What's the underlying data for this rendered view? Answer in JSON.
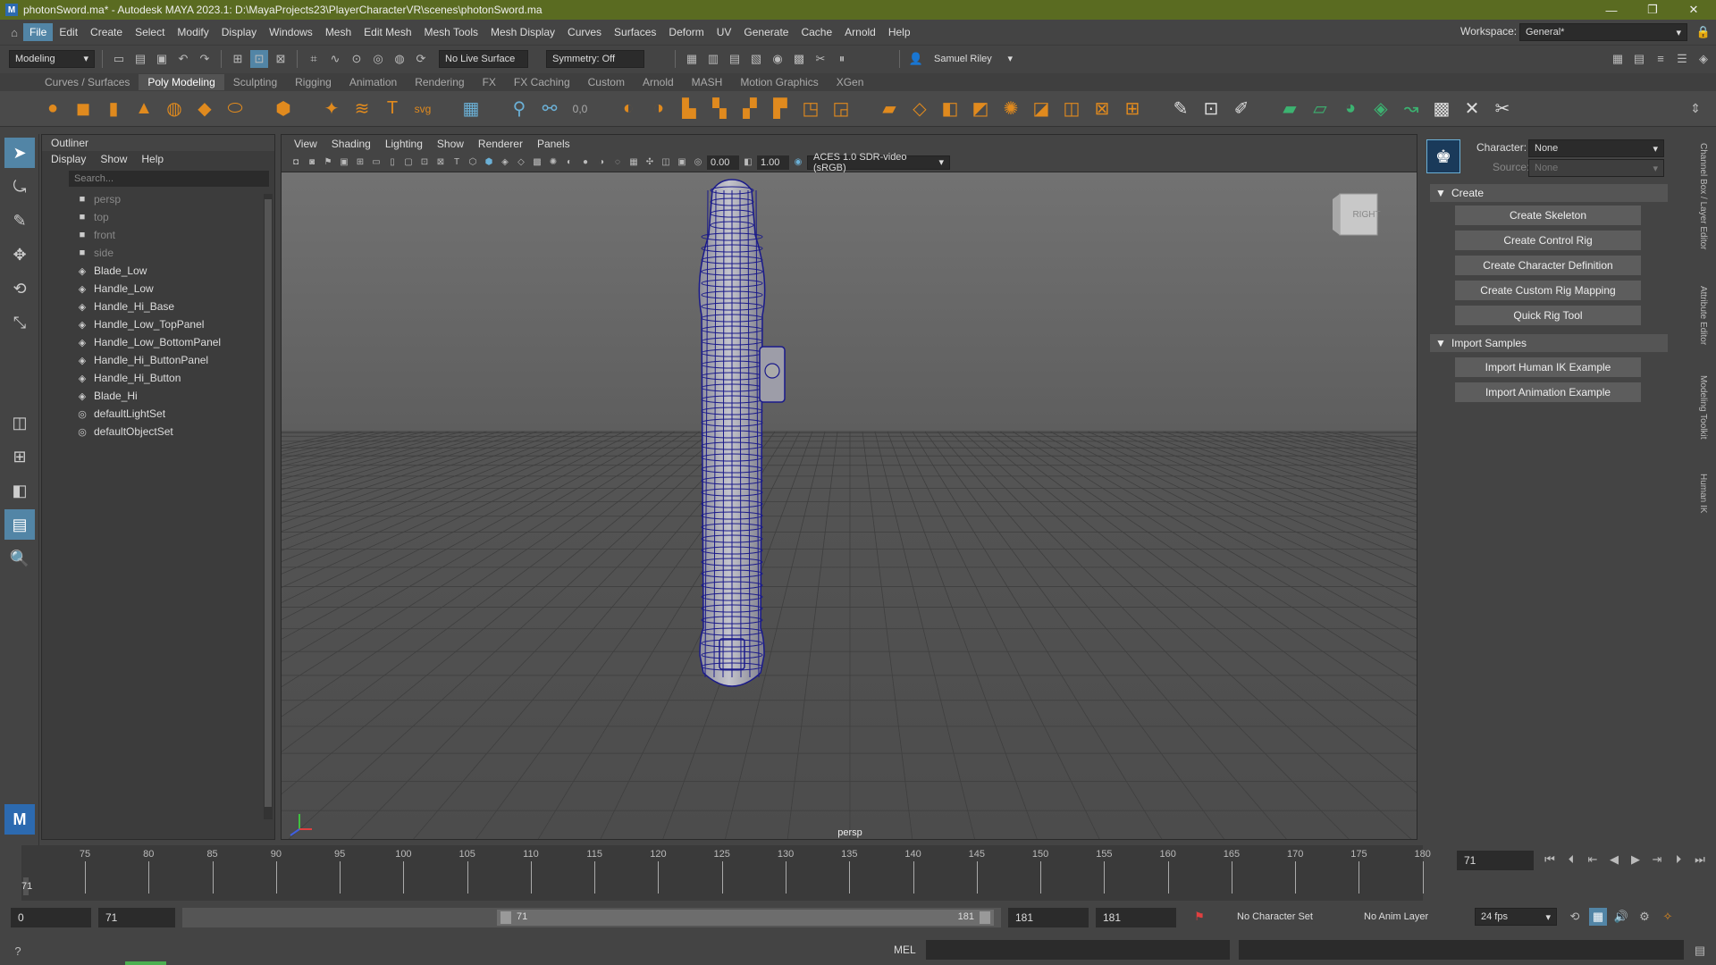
{
  "titlebar": {
    "title": "photonSword.ma* - Autodesk MAYA 2023.1: D:\\MayaProjects23\\PlayerCharacterVR\\scenes\\photonSword.ma",
    "minimize": "—",
    "maximize": "❐",
    "close": "✕"
  },
  "menubar": {
    "items": [
      "File",
      "Edit",
      "Create",
      "Select",
      "Modify",
      "Display",
      "Windows",
      "Mesh",
      "Edit Mesh",
      "Mesh Tools",
      "Mesh Display",
      "Curves",
      "Surfaces",
      "Deform",
      "UV",
      "Generate",
      "Cache",
      "Arnold",
      "Help"
    ],
    "workspace_label": "Workspace:",
    "workspace_value": "General*"
  },
  "statusline": {
    "mode": "Modeling",
    "live_surface": "No Live Surface",
    "symmetry": "Symmetry: Off",
    "user": "Samuel Riley"
  },
  "shelf": {
    "tabs": [
      "Curves / Surfaces",
      "Poly Modeling",
      "Sculpting",
      "Rigging",
      "Animation",
      "Rendering",
      "FX",
      "FX Caching",
      "Custom",
      "Arnold",
      "MASH",
      "Motion Graphics",
      "XGen"
    ],
    "active_tab": "Poly Modeling"
  },
  "outliner": {
    "title": "Outliner",
    "menu": [
      "Display",
      "Show",
      "Help"
    ],
    "search_placeholder": "Search...",
    "items": [
      {
        "label": "persp",
        "icon": "camera-icon",
        "dim": true
      },
      {
        "label": "top",
        "icon": "camera-icon",
        "dim": true
      },
      {
        "label": "front",
        "icon": "camera-icon",
        "dim": true
      },
      {
        "label": "side",
        "icon": "camera-icon",
        "dim": true
      },
      {
        "label": "Blade_Low",
        "icon": "mesh-icon",
        "dim": false
      },
      {
        "label": "Handle_Low",
        "icon": "mesh-icon",
        "dim": false
      },
      {
        "label": "Handle_Hi_Base",
        "icon": "mesh-icon",
        "dim": false
      },
      {
        "label": "Handle_Low_TopPanel",
        "icon": "mesh-icon",
        "dim": false
      },
      {
        "label": "Handle_Low_BottomPanel",
        "icon": "mesh-icon",
        "dim": false
      },
      {
        "label": "Handle_Hi_ButtonPanel",
        "icon": "mesh-icon",
        "dim": false
      },
      {
        "label": "Handle_Hi_Button",
        "icon": "mesh-icon",
        "dim": false
      },
      {
        "label": "Blade_Hi",
        "icon": "mesh-icon",
        "dim": false
      },
      {
        "label": "defaultLightSet",
        "icon": "set-icon",
        "dim": false
      },
      {
        "label": "defaultObjectSet",
        "icon": "set-icon",
        "dim": false
      }
    ]
  },
  "viewport": {
    "menu": [
      "View",
      "Shading",
      "Lighting",
      "Show",
      "Renderer",
      "Panels"
    ],
    "exposure": "0.00",
    "gamma": "1.00",
    "colorspace": "ACES 1.0 SDR-video (sRGB)",
    "camera_label": "persp",
    "viewcube_label": "RIGHT"
  },
  "character_panel": {
    "character_label": "Character:",
    "character_value": "None",
    "source_label": "Source:",
    "source_value": "None",
    "create_section": "Create",
    "create_buttons": [
      "Create Skeleton",
      "Create Control Rig",
      "Create Character Definition",
      "Create Custom Rig Mapping",
      "Quick Rig Tool"
    ],
    "import_section": "Import Samples",
    "import_buttons": [
      "Import Human IK Example",
      "Import Animation Example"
    ]
  },
  "side_tabs": [
    "Channel Box / Layer Editor",
    "Attribute Editor",
    "Modeling Toolkit",
    "Human IK"
  ],
  "timeline": {
    "ticks": [
      75,
      80,
      85,
      90,
      95,
      100,
      105,
      110,
      115,
      120,
      125,
      130,
      135,
      140,
      145,
      150,
      155,
      160,
      165,
      170,
      175,
      180
    ],
    "current_frame": "71",
    "current_frame_field": "71"
  },
  "range": {
    "start": "0",
    "playback_start": "71",
    "slider_start": "71",
    "slider_end": "181",
    "playback_end": "181",
    "end": "181",
    "character_set": "No Character Set",
    "anim_layer": "No Anim Layer",
    "fps": "24 fps"
  },
  "cmdline": {
    "lang": "MEL"
  },
  "colors": {
    "accent": "#5285a6",
    "titlebar": "#5a6b21",
    "mesh": "#1a1a8a"
  }
}
